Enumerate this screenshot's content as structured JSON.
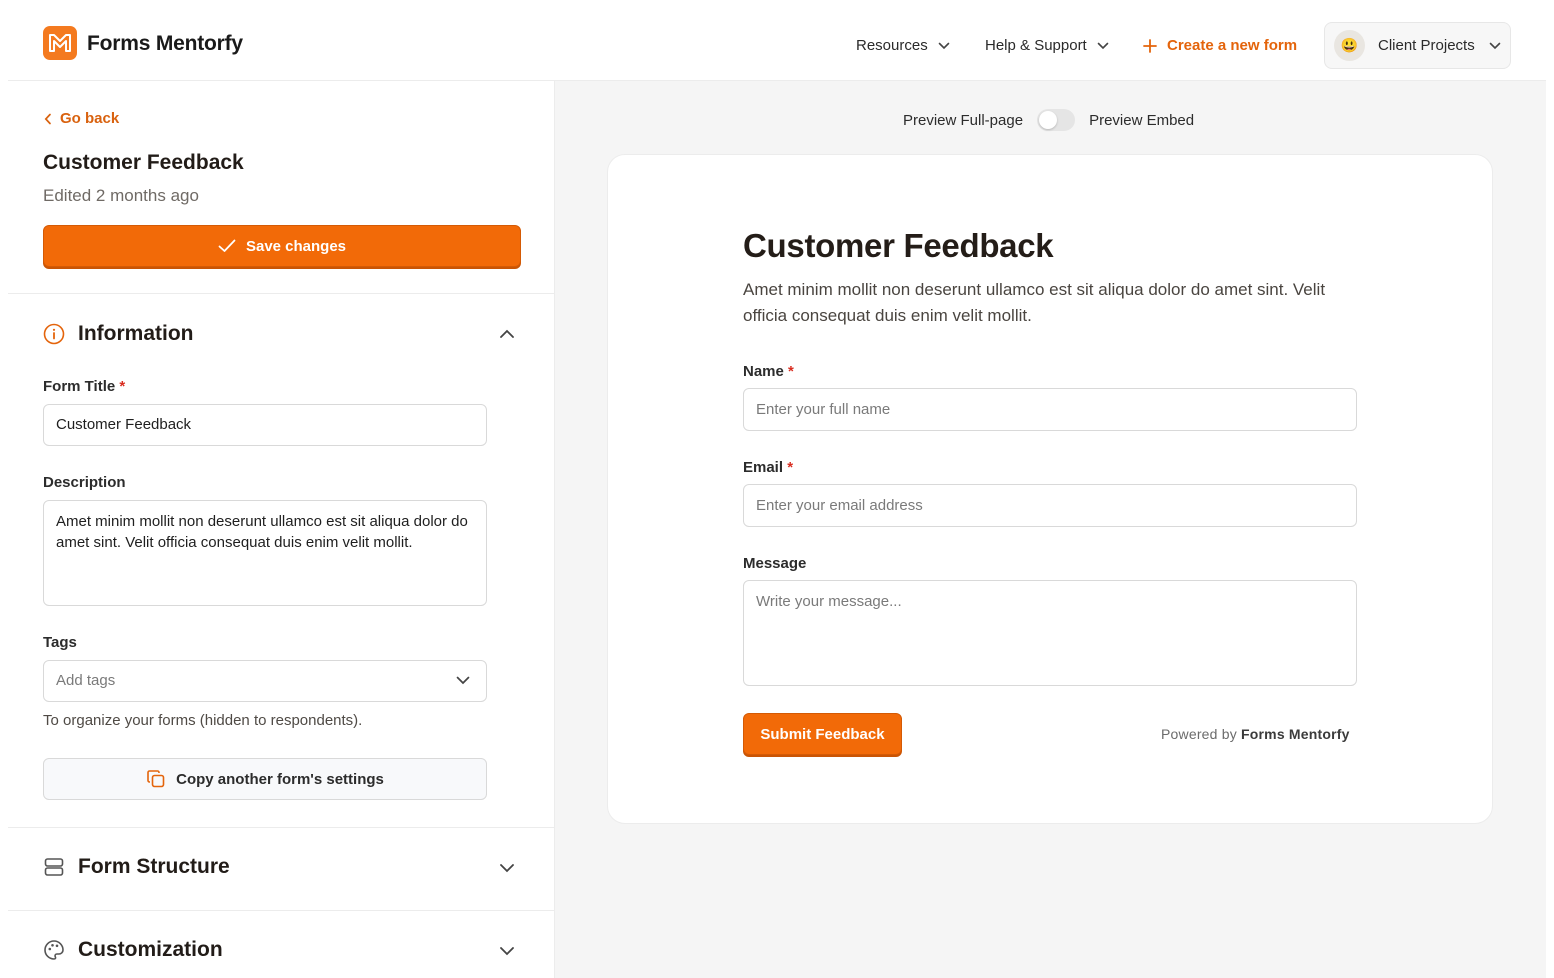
{
  "brand": {
    "name": "Forms Mentorfy",
    "accent": "#f26a08",
    "link_color": "#e4640b"
  },
  "header": {
    "nav": [
      {
        "label": "Resources",
        "icon": "chevron-down-icon"
      },
      {
        "label": "Help & Support",
        "icon": "chevron-down-icon"
      }
    ],
    "create_label": "Create a new form",
    "account": {
      "avatar": "😃",
      "label": "Client Projects"
    }
  },
  "sidebar": {
    "back_label": "Go back",
    "title": "Customer Feedback",
    "subtitle": "Edited 2 months ago",
    "save_label": "Save changes",
    "information": {
      "title": "Information",
      "expanded": true,
      "form_title_label": "Form Title",
      "form_title_value": "Customer Feedback",
      "required_mark": "*",
      "description_label": "Description",
      "description_value": "Amet minim mollit non deserunt ullamco est sit aliqua dolor do amet sint. Velit officia consequat duis enim velit mollit.",
      "tags_label": "Tags",
      "tags_placeholder": "Add tags",
      "tags_helper": "To organize your forms (hidden to respondents).",
      "copy_label": "Copy another form's settings"
    },
    "sections": [
      {
        "title": "Form Structure",
        "icon": "layout-icon"
      },
      {
        "title": "Customization",
        "icon": "palette-icon"
      }
    ]
  },
  "preview": {
    "toggle_left": "Preview Full-page",
    "toggle_right": "Preview Embed",
    "form": {
      "title": "Customer Feedback",
      "description": "Amet minim mollit non deserunt ullamco est sit aliqua dolor do amet sint. Velit officia consequat duis enim velit mollit.",
      "fields": {
        "name_label": "Name",
        "name_placeholder": "Enter your full name",
        "email_label": "Email",
        "email_placeholder": "Enter your email address",
        "message_label": "Message",
        "message_placeholder": "Write your message..."
      },
      "submit_label": "Submit Feedback",
      "powered_prefix": "Powered by",
      "powered_brand": "Forms Mentorfy"
    }
  }
}
